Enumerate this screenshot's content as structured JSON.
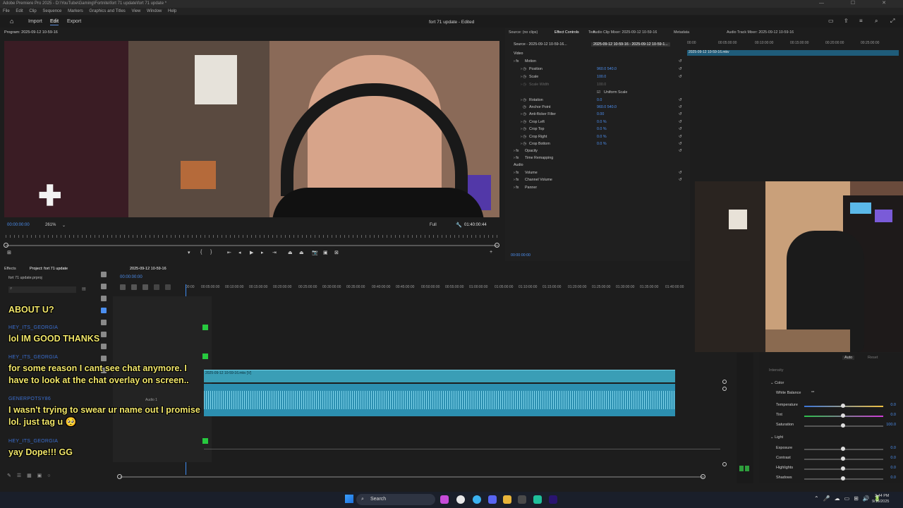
{
  "window": {
    "title": "Adobe Premiere Pro 2025 - D:\\YouTube\\Gaming\\Fortnite\\fort 71 update\\fort 71 update *",
    "controls": "— ☐ ✕"
  },
  "menu": [
    "File",
    "Edit",
    "Clip",
    "Sequence",
    "Markers",
    "Graphics and Titles",
    "View",
    "Window",
    "Help"
  ],
  "workspace": {
    "tabs": [
      "Import",
      "Edit",
      "Export"
    ],
    "active": "Edit",
    "document_title": "fort 71 update - Edited"
  },
  "program_monitor": {
    "title": "Program: 2025-09-12 10-59-16",
    "timecode": "00:00:00:00",
    "zoom": "261%",
    "resolution": "Full",
    "duration": "01:40:00:44"
  },
  "effect_controls": {
    "tabs": [
      "Source: (no clips)",
      "Effect Controls",
      "Audio Clip Mixer: 2025-09-12 10-59-16",
      "Metadata",
      "Text",
      "Audio Track Mixer: 2025-09-12 10-59-16"
    ],
    "source": "Source - 2025-09-12 10-59-16...",
    "clip": "2025-09-12 10-59-16 - 2025-09-12 10-59-1...",
    "video_label": "Video",
    "rows": [
      {
        "name": "Motion",
        "value": ""
      },
      {
        "name": "Position",
        "value": "960.0   540.0"
      },
      {
        "name": "Scale",
        "value": "100.0"
      },
      {
        "name": "Scale Width",
        "value": "100.0"
      },
      {
        "name": "Uniform Scale",
        "value": ""
      },
      {
        "name": "Rotation",
        "value": "0.0"
      },
      {
        "name": "Anchor Point",
        "value": "960.0   540.0"
      },
      {
        "name": "Anti-flicker Filter",
        "value": "0.00"
      },
      {
        "name": "Crop Left",
        "value": "0.0 %"
      },
      {
        "name": "Crop Top",
        "value": "0.0 %"
      },
      {
        "name": "Crop Right",
        "value": "0.0 %"
      },
      {
        "name": "Crop Bottom",
        "value": "0.0 %"
      },
      {
        "name": "Opacity",
        "value": ""
      },
      {
        "name": "Time Remapping",
        "value": ""
      }
    ],
    "audio_label": "Audio",
    "audio_rows": [
      "Volume",
      "Channel Volume",
      "Panner"
    ],
    "timecode": "00:00:00:00",
    "mini_clip": "2025-09-12 10-59-16.mkv",
    "mini_ruler": [
      "00:00",
      "00:05:00:00",
      "00:10:00:00",
      "00:15:00:00",
      "00:20:00:00",
      "00:25:00:00"
    ]
  },
  "project": {
    "tabs": [
      "Effects",
      "Project: fort 71 update"
    ],
    "file": "fort 71 update.prproj"
  },
  "sequence": {
    "tab": "2025-09-12 10-59-16",
    "timecode": "00:00:00:00",
    "ruler": [
      "00:00",
      "00:05:00:00",
      "00:10:00:00",
      "00:15:00:00",
      "00:20:00:00",
      "00:25:00:00",
      "00:30:00:00",
      "00:35:00:00",
      "00:40:00:00",
      "00:45:00:00",
      "00:50:00:00",
      "00:55:00:00",
      "01:00:00:00",
      "01:05:00:00",
      "01:10:00:00",
      "01:15:00:00",
      "01:20:00:00",
      "01:25:00:00",
      "01:30:00:00",
      "01:35:00:00",
      "01:40:00:00"
    ],
    "video_clip": "2025-09-12 10-59-16.mkv [V]",
    "audio_track": "Audio 1"
  },
  "chat": [
    {
      "user": "",
      "msg": "ABOUT U?"
    },
    {
      "user": "HEY_ITS_GEORGIA",
      "msg": "lol IM GOOD THANKS"
    },
    {
      "user": "HEY_ITS_GEORGIA",
      "msg": "for some reason I cant see chat anymore. I have to look at the chat overlay on screen.."
    },
    {
      "user": "GENERPOTSY86",
      "msg": "I wasn't trying to swear ur name out I promise lol. just tag u 🥺"
    },
    {
      "user": "HEY_ITS_GEORGIA",
      "msg": "yay Dope!!! GG"
    }
  ],
  "lumetri": {
    "intensity": "Intensity",
    "auto": "Auto",
    "reset": "Reset",
    "color_section": "Color",
    "white_balance": "White Balance",
    "sliders_color": [
      {
        "name": "Temperature",
        "value": "0.0"
      },
      {
        "name": "Tint",
        "value": "0.0"
      },
      {
        "name": "Saturation",
        "value": "100.0"
      }
    ],
    "light_section": "Light",
    "sliders_light": [
      {
        "name": "Exposure",
        "value": "0.0"
      },
      {
        "name": "Contrast",
        "value": "0.0"
      },
      {
        "name": "Highlights",
        "value": "0.0"
      },
      {
        "name": "Shadows",
        "value": "0.0"
      }
    ]
  },
  "taskbar": {
    "search": "Search",
    "time": "3:44 PM",
    "date": "9/16/2025"
  }
}
